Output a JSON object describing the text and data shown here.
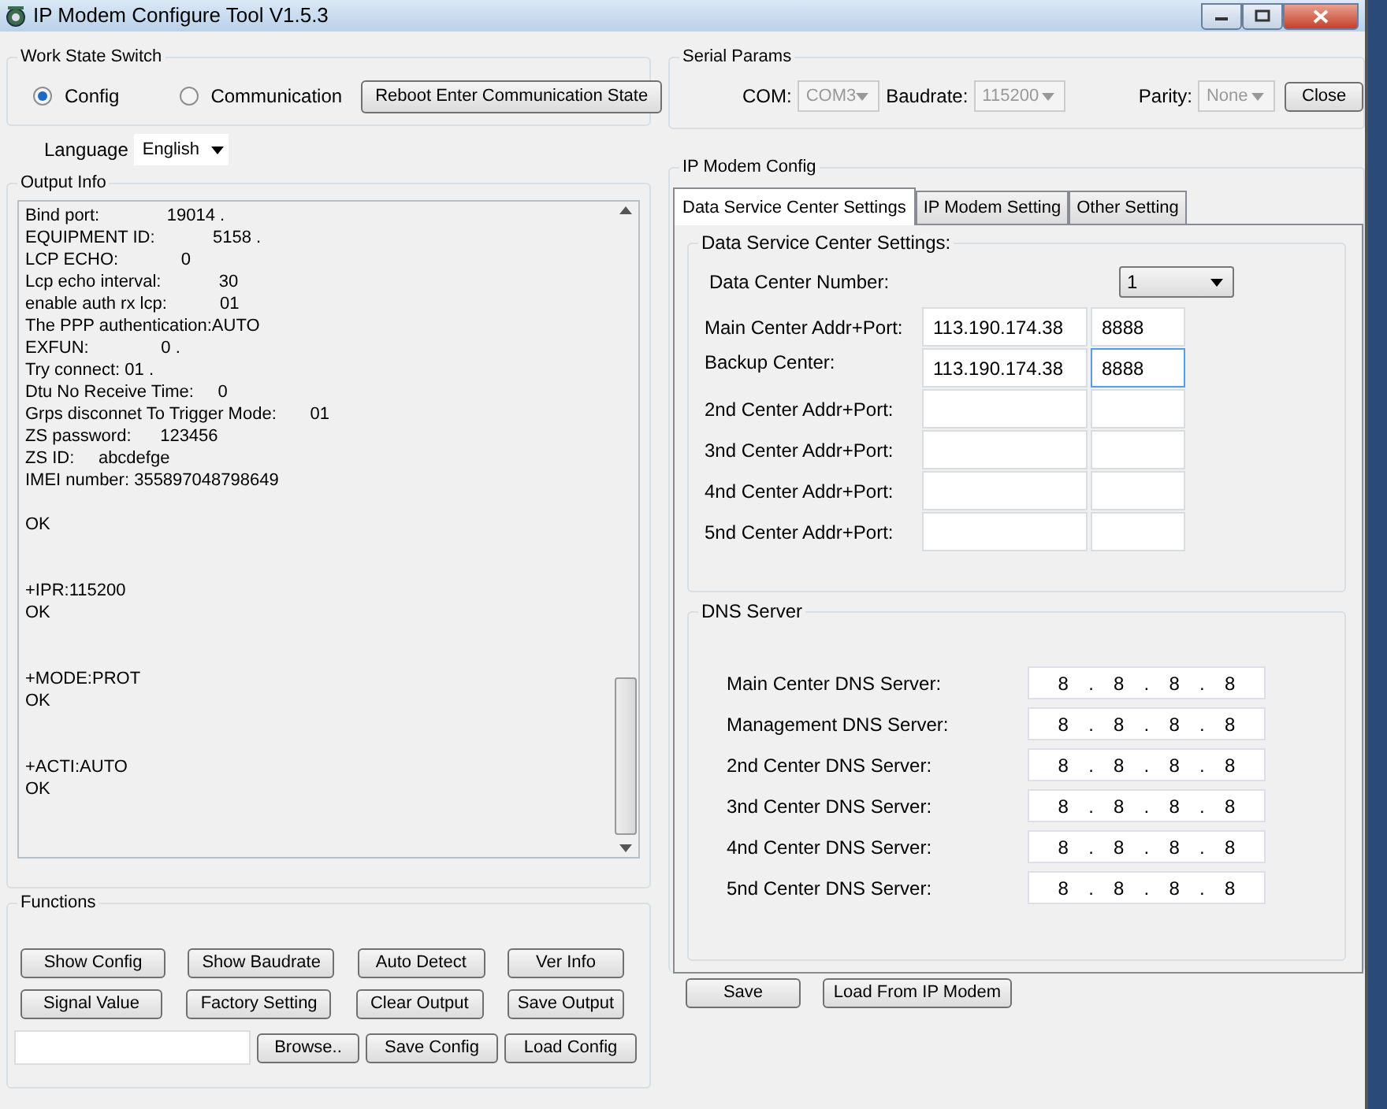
{
  "window": {
    "title": "IP Modem Configure Tool V1.5.3"
  },
  "work_state": {
    "title": "Work State Switch",
    "options": [
      {
        "label": "Config",
        "selected": true
      },
      {
        "label": "Communication",
        "selected": false
      }
    ],
    "button": "Reboot Enter Communication State"
  },
  "language": {
    "label": "Language",
    "value": "English"
  },
  "output": {
    "title": "Output Info",
    "blocks": [
      [
        "Bind port:              19014 .",
        "EQUIPMENT ID:            5158 .",
        "LCP ECHO:             0",
        "Lcp echo interval:            30",
        "enable auth rx lcp:           01",
        "The PPP authentication:AUTO",
        "EXFUN:               0 .",
        "Try connect: 01 .",
        "Dtu No Receive Time:     0",
        "Grps disconnet To Trigger Mode:       01",
        "ZS password:      123456",
        "ZS ID:     abcdefge",
        "IMEI number: 355897048798649"
      ],
      [
        "OK"
      ],
      [
        "+IPR:115200",
        "OK"
      ],
      [
        "+MODE:PROT",
        "OK"
      ],
      [
        "+ACTI:AUTO",
        "OK"
      ]
    ]
  },
  "functions": {
    "title": "Functions",
    "rows": [
      [
        "Show Config",
        "Show Baudrate",
        "Auto Detect",
        "Ver Info"
      ],
      [
        "Signal Value",
        "Factory Setting",
        "Clear Output",
        "Save Output"
      ]
    ],
    "browse": "Browse..",
    "save_config": "Save Config",
    "load_config": "Load Config"
  },
  "serial": {
    "title": "Serial Params",
    "combos": [
      {
        "label": "COM:",
        "value": "COM3",
        "disabled": true
      },
      {
        "label": "Baudrate:",
        "value": "115200",
        "disabled": true
      },
      {
        "label": "Parity:",
        "value": "None",
        "disabled": true
      }
    ],
    "button": "Close"
  },
  "config": {
    "title": "IP Modem Config",
    "tabs": [
      {
        "label": "Data Service Center Settings",
        "selected": true
      },
      {
        "label": "IP Modem Setting",
        "selected": false
      },
      {
        "label": "Other Setting",
        "selected": false
      }
    ],
    "dsc": {
      "title": "Data Service Center Settings:",
      "number_label": "Data Center Number:",
      "number_value": "1",
      "centers": [
        {
          "label": "Main Center Addr+Port:",
          "addr": "113.190.174.38",
          "port": "8888",
          "focused": false
        },
        {
          "label": "Backup Center:",
          "addr": "113.190.174.38",
          "port": "8888",
          "focused": true
        },
        {
          "label": "2nd Center Addr+Port:",
          "focused": false
        },
        {
          "label": "3nd Center Addr+Port:",
          "focused": false
        },
        {
          "label": "4nd Center Addr+Port:",
          "focused": false
        },
        {
          "label": "5nd Center Addr+Port:",
          "focused": false
        }
      ]
    },
    "dns": {
      "title": "DNS Server",
      "separator": ".",
      "servers": [
        {
          "label": "Main Center DNS Server:",
          "octets": [
            "8",
            "8",
            "8",
            "8"
          ]
        },
        {
          "label": "Management DNS Server:",
          "octets": [
            "8",
            "8",
            "8",
            "8"
          ]
        },
        {
          "label": "2nd Center DNS Server:",
          "octets": [
            "8",
            "8",
            "8",
            "8"
          ]
        },
        {
          "label": "3nd Center DNS Server:",
          "octets": [
            "8",
            "8",
            "8",
            "8"
          ]
        },
        {
          "label": "4nd Center DNS Server:",
          "octets": [
            "8",
            "8",
            "8",
            "8"
          ]
        },
        {
          "label": "5nd Center DNS Server:",
          "octets": [
            "8",
            "8",
            "8",
            "8"
          ]
        }
      ]
    },
    "buttons": [
      "Save",
      "Load From IP Modem"
    ]
  }
}
